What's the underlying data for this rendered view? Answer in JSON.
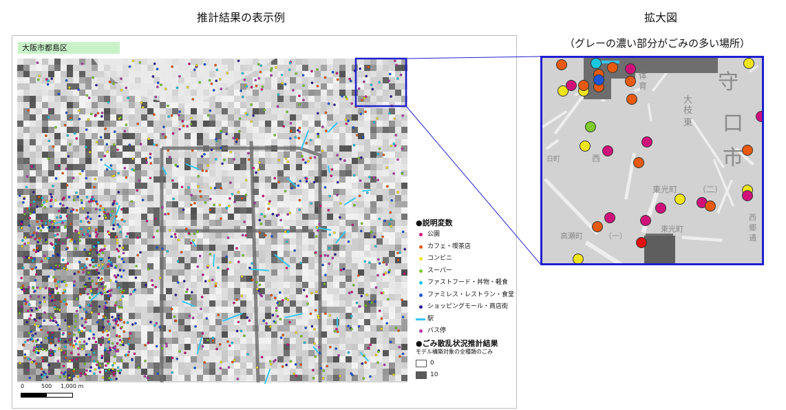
{
  "titles": {
    "left": "推計結果の表示例",
    "right": "拡大図",
    "right_sub": "（グレーの濃い部分がごみの多い場所）"
  },
  "map": {
    "district": "大阪市都島区"
  },
  "legend": {
    "section1_title": "●説明変数",
    "items": [
      {
        "label": "公園",
        "color": "#d0117a",
        "kind": "dot"
      },
      {
        "label": "カフェ・喫茶店",
        "color": "#e85a10",
        "kind": "dot"
      },
      {
        "label": "コンビニ",
        "color": "#f0e41a",
        "kind": "dot"
      },
      {
        "label": "スーパー",
        "color": "#7ecb2a",
        "kind": "dot"
      },
      {
        "label": "ファストフード・丼物・軽食",
        "color": "#19c7e0",
        "kind": "dot"
      },
      {
        "label": "ファミレス・レストラン・食堂",
        "color": "#1f55d8",
        "kind": "dot"
      },
      {
        "label": "ショッピングモール・商店街",
        "color": "#2a1c9a",
        "kind": "dot"
      },
      {
        "label": "駅",
        "color": "#34c6f0",
        "kind": "line"
      },
      {
        "label": "バス停",
        "color": "#b23aa6",
        "kind": "dot"
      }
    ],
    "section2_title": "●ごみ散乱状況推計結果",
    "gradient_caption": "モデル構築対象の全種類のごみ",
    "low_label": "0",
    "high_label": "10",
    "low_color": "#ffffff",
    "high_color": "#5a5a5a"
  },
  "scale_bar": {
    "labels": [
      "0",
      "500",
      "1,000 m"
    ]
  },
  "zoom_labels": [
    "守",
    "口",
    "市",
    "大",
    "枝",
    "東",
    "西",
    "東光町",
    "（二）",
    "東光町",
    "高瀬町",
    "（一）",
    "日町",
    "体",
    "育",
    "西",
    "郷",
    "通"
  ]
}
